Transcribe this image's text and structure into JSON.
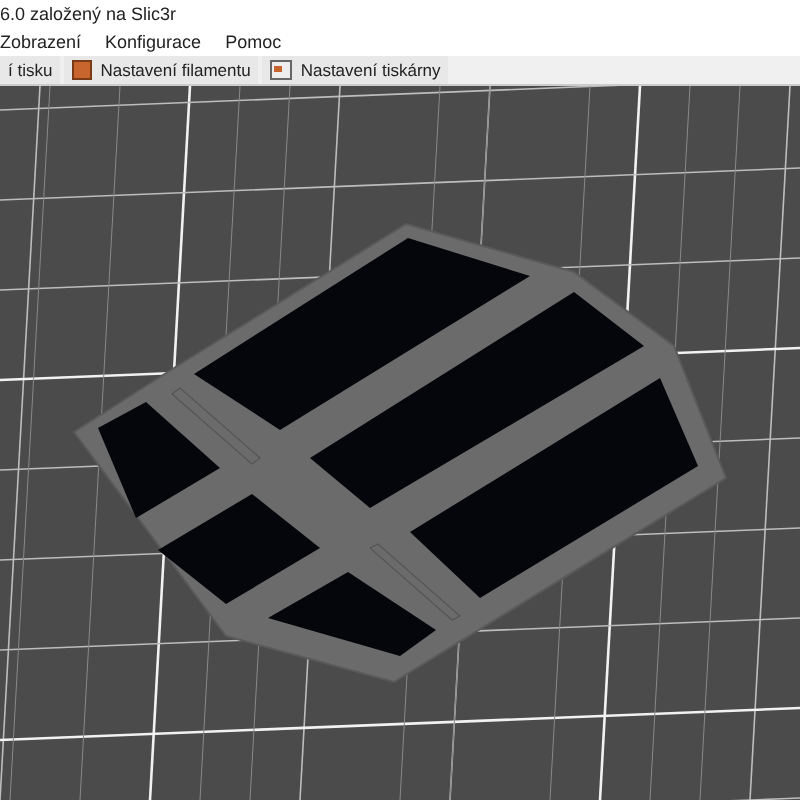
{
  "window": {
    "title": "6.0 založený na Slic3r"
  },
  "menu": [
    "Zobrazení",
    "Konfigurace",
    "Pomoc"
  ],
  "tabs": [
    {
      "label": "í tisku",
      "kind": "print",
      "selected": false
    },
    {
      "label": "Nastavení filamentu",
      "kind": "filament",
      "selected": false
    },
    {
      "label": "Nastavení tiskárny",
      "kind": "printer",
      "selected": false
    }
  ]
}
